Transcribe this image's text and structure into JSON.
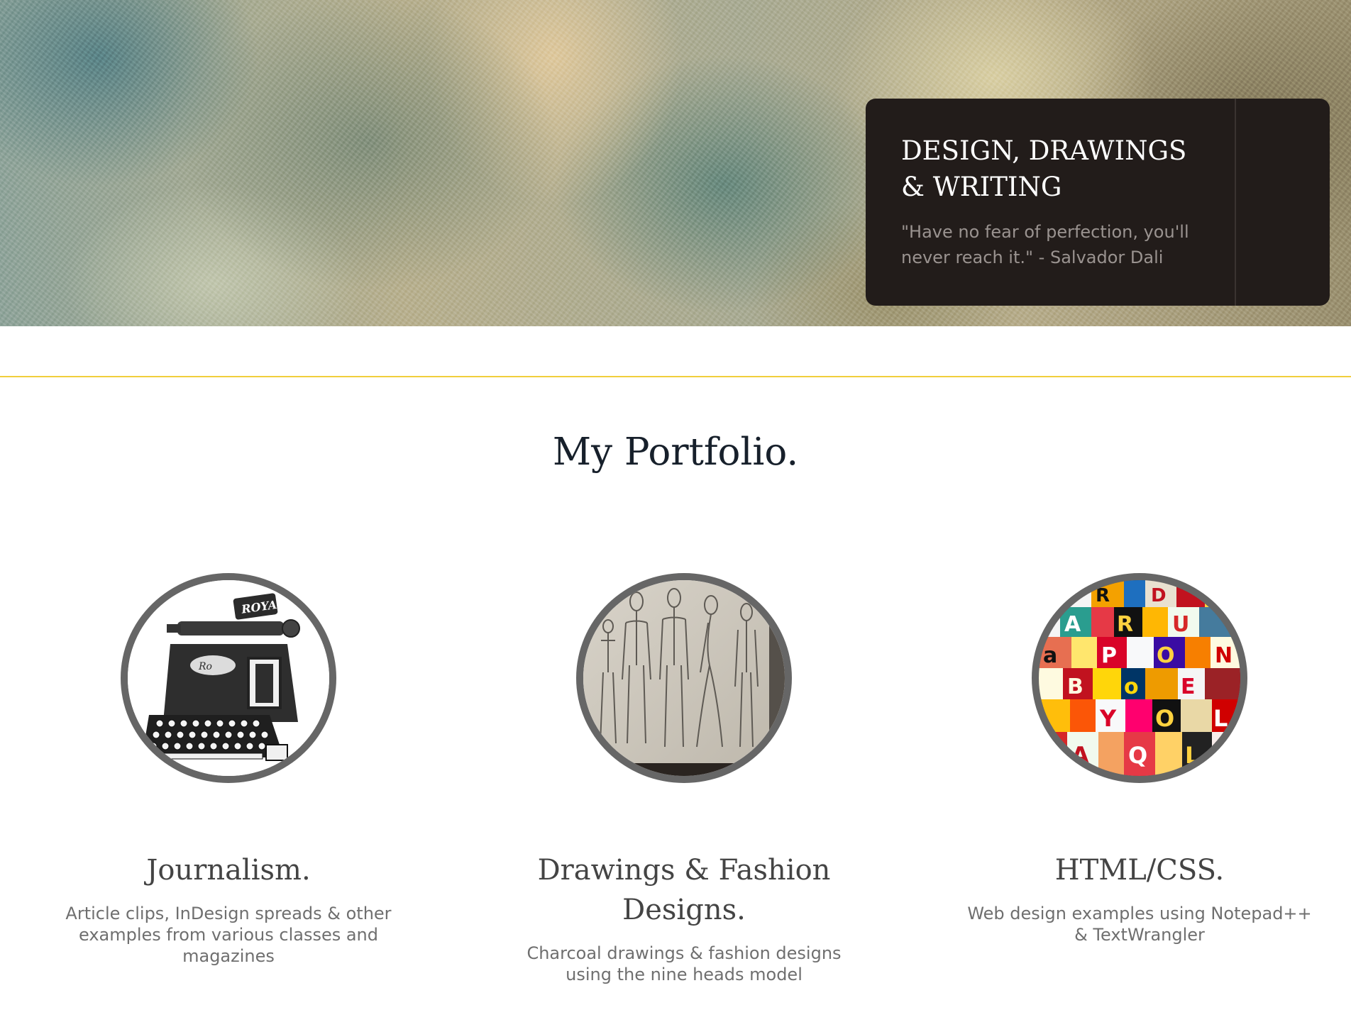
{
  "hero": {
    "title": "DESIGN, DRAWINGS & WRITING",
    "quote": "\"Have no fear of perfection, you'll never reach it.\" - Salvador Dali"
  },
  "main": {
    "heading": "My Portfolio.",
    "items": [
      {
        "title": "Journalism.",
        "description": "Article clips, InDesign spreads & other examples from various classes and magazines",
        "image": "typewriter-image",
        "image_text": "ROYAL"
      },
      {
        "title": "Drawings & Fashion Designs.",
        "description": "Charcoal drawings & fashion designs using the nine heads model",
        "image": "fashion-sketches-image"
      },
      {
        "title": "HTML/CSS.",
        "description": "Web design examples using Notepad++ & TextWrangler",
        "image": "letter-collage-image"
      }
    ]
  },
  "colors": {
    "hero_card": "#221c1a",
    "accent_rule": "#f1cf3c",
    "heading": "#17202b",
    "thumb_border": "#666666"
  }
}
